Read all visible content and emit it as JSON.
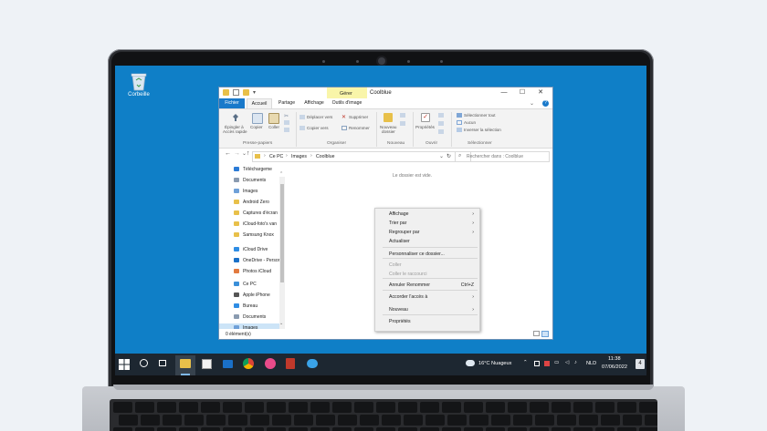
{
  "desktop": {
    "recycle_bin_label": "Corbeille"
  },
  "window": {
    "title": "Coolblue",
    "context_tab": "Gérer",
    "controls": [
      "—",
      "☐",
      "✕"
    ],
    "tabs": [
      "Fichier",
      "Accueil",
      "Partage",
      "Affichage",
      "Outils d'image"
    ],
    "ribbon": {
      "pin_label_1": "Épingler à",
      "pin_label_2": "Accès rapide",
      "copy": "Copier",
      "paste": "Coller",
      "move_to": "Déplacer vers",
      "copy_to": "Copier vers",
      "delete": "Supprimer",
      "rename": "Renommer",
      "new_folder_1": "Nouveau",
      "new_folder_2": "dossier",
      "properties": "Propriétés",
      "select_all": "Sélectionner tout",
      "select_none": "Aucun",
      "invert_selection": "Inverser la sélection",
      "groups": [
        "Presse-papiers",
        "Organiser",
        "Nouveau",
        "Ouvrir",
        "Sélectionner"
      ]
    },
    "address": {
      "crumbs": [
        "Ce PC",
        "Images",
        "Coolblue"
      ],
      "search_placeholder": "Rechercher dans : Coolblue"
    },
    "nav_items": [
      {
        "label": "Téléchargeme",
        "icon": "download-icon",
        "color": "#2b7bd6"
      },
      {
        "label": "Documents",
        "icon": "document-icon",
        "color": "#8a9bb0"
      },
      {
        "label": "Images",
        "icon": "images-icon",
        "color": "#6fa0d8"
      },
      {
        "label": "Android Zero",
        "icon": "folder-icon",
        "color": "#e8c04a"
      },
      {
        "label": "Captures d'écran",
        "icon": "folder-icon",
        "color": "#e8c04a"
      },
      {
        "label": "iCloud-foto's van",
        "icon": "folder-icon",
        "color": "#e8c04a"
      },
      {
        "label": "Samsung Knox",
        "icon": "folder-icon",
        "color": "#e8c04a"
      },
      {
        "label": "iCloud Drive",
        "icon": "cloud-icon",
        "color": "#2f8de4"
      },
      {
        "label": "OneDrive - Person",
        "icon": "onedrive-icon",
        "color": "#1a70c8"
      },
      {
        "label": "Photos iCloud",
        "icon": "photos-icon",
        "color": "#e27a3f"
      },
      {
        "label": "Ce PC",
        "icon": "pc-icon",
        "color": "#3a8fd9"
      },
      {
        "label": "Apple iPhone",
        "icon": "phone-icon",
        "color": "#555555"
      },
      {
        "label": "Bureau",
        "icon": "desktop-icon",
        "color": "#2f8de4"
      },
      {
        "label": "Documents",
        "icon": "document-icon",
        "color": "#8a9bb0"
      },
      {
        "label": "Images",
        "icon": "images-icon",
        "color": "#6fa0d8"
      }
    ],
    "empty_text": "Le dossier est vide.",
    "status": "0 élément(s)"
  },
  "context_menu": {
    "items": [
      {
        "label": "Affichage",
        "arrow": "›",
        "shortcut": "",
        "disabled": false
      },
      {
        "label": "Trier par",
        "arrow": "›",
        "shortcut": "",
        "disabled": false
      },
      {
        "label": "Regrouper par",
        "arrow": "›",
        "shortcut": "",
        "disabled": false
      },
      {
        "label": "Actualiser",
        "arrow": "",
        "shortcut": "",
        "disabled": false
      },
      {
        "label": "Personnaliser ce dossier...",
        "arrow": "",
        "shortcut": "",
        "disabled": false
      },
      {
        "label": "Coller",
        "arrow": "",
        "shortcut": "",
        "disabled": true
      },
      {
        "label": "Coller le raccourci",
        "arrow": "",
        "shortcut": "",
        "disabled": true
      },
      {
        "label": "Annuler Renommer",
        "arrow": "",
        "shortcut": "Ctrl+Z",
        "disabled": false
      },
      {
        "label": "Accorder l'accès à",
        "arrow": "›",
        "shortcut": "",
        "disabled": false
      },
      {
        "label": "Nouveau",
        "arrow": "›",
        "shortcut": "",
        "disabled": false
      },
      {
        "label": "Propriétés",
        "arrow": "",
        "shortcut": "",
        "disabled": false
      }
    ]
  },
  "taskbar": {
    "weather": "16°C Nuageux",
    "language": "NLD",
    "time": "11:38",
    "date": "07/06/2022",
    "notification_count": "4"
  },
  "colors": {
    "desktop": "#0f7fc7",
    "taskbar": "#1d2731",
    "accent": "#1979ca"
  }
}
